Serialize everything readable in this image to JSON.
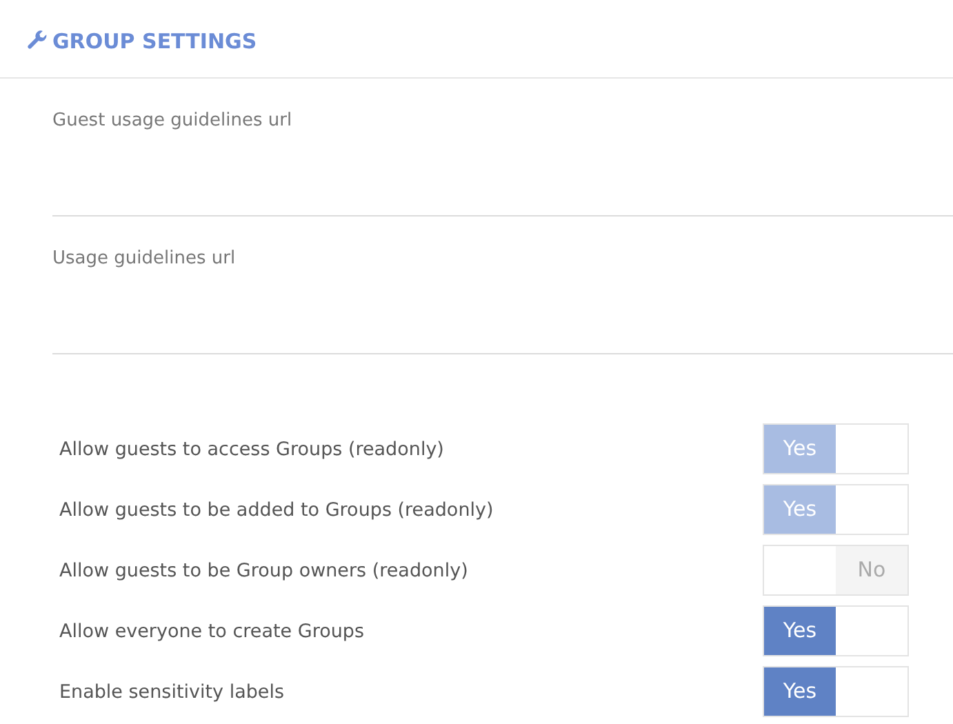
{
  "section": {
    "title": "GROUP SETTINGS"
  },
  "fields": [
    {
      "label": "Guest usage guidelines url"
    },
    {
      "label": "Usage guidelines url"
    }
  ],
  "toggles": [
    {
      "label": "Allow guests to access Groups (readonly)",
      "on": true,
      "disabled": true,
      "text": "Yes"
    },
    {
      "label": "Allow guests to be added to Groups (readonly)",
      "on": true,
      "disabled": true,
      "text": "Yes"
    },
    {
      "label": "Allow guests to be Group owners (readonly)",
      "on": false,
      "disabled": true,
      "text": "No"
    },
    {
      "label": "Allow everyone to create Groups",
      "on": true,
      "disabled": false,
      "text": "Yes"
    },
    {
      "label": "Enable sensitivity labels",
      "on": true,
      "disabled": false,
      "text": "Yes"
    }
  ]
}
